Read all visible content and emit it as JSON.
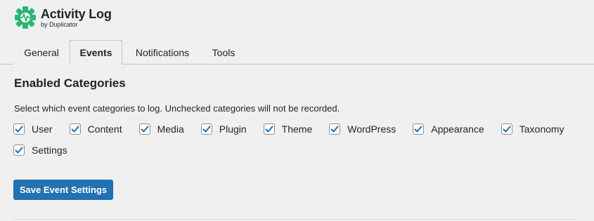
{
  "header": {
    "title": "Activity Log",
    "subtitle": "by Duplicator",
    "logo_icon": "gear-pulse-icon",
    "brand_color": "#2bb673"
  },
  "tabs": [
    {
      "label": "General",
      "active": false
    },
    {
      "label": "Events",
      "active": true
    },
    {
      "label": "Notifications",
      "active": false
    },
    {
      "label": "Tools",
      "active": false
    }
  ],
  "main": {
    "section_title": "Enabled Categories",
    "description": "Select which event categories to log. Unchecked categories will not be recorded.",
    "categories": [
      {
        "label": "User",
        "checked": true
      },
      {
        "label": "Content",
        "checked": true
      },
      {
        "label": "Media",
        "checked": true
      },
      {
        "label": "Plugin",
        "checked": true
      },
      {
        "label": "Theme",
        "checked": true
      },
      {
        "label": "WordPress",
        "checked": true
      },
      {
        "label": "Appearance",
        "checked": true
      },
      {
        "label": "Taxonomy",
        "checked": true
      },
      {
        "label": "Settings",
        "checked": true
      }
    ],
    "save_button_label": "Save Event Settings",
    "accent_color": "#2271b1"
  }
}
